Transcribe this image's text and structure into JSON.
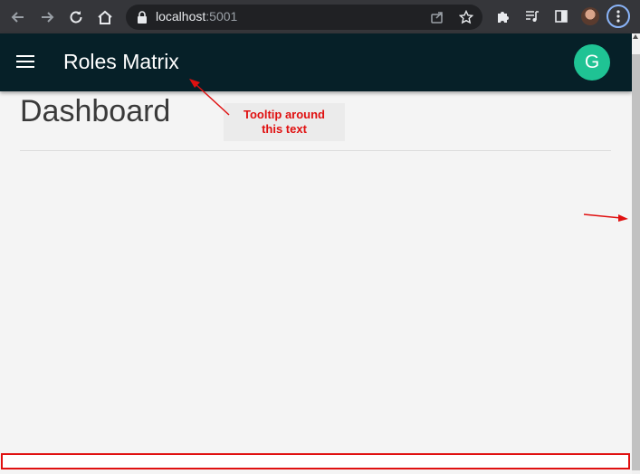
{
  "browser": {
    "url_host": "localhost",
    "url_port": ":5001"
  },
  "app": {
    "title": "Roles Matrix",
    "user_initial": "G",
    "avatar_color": "#1fc394",
    "header_color": "#062028"
  },
  "page": {
    "title": "Dashboard"
  },
  "annotations": {
    "tooltip_line1": "Tooltip around",
    "tooltip_line2": "this text",
    "color": "#e01010"
  }
}
